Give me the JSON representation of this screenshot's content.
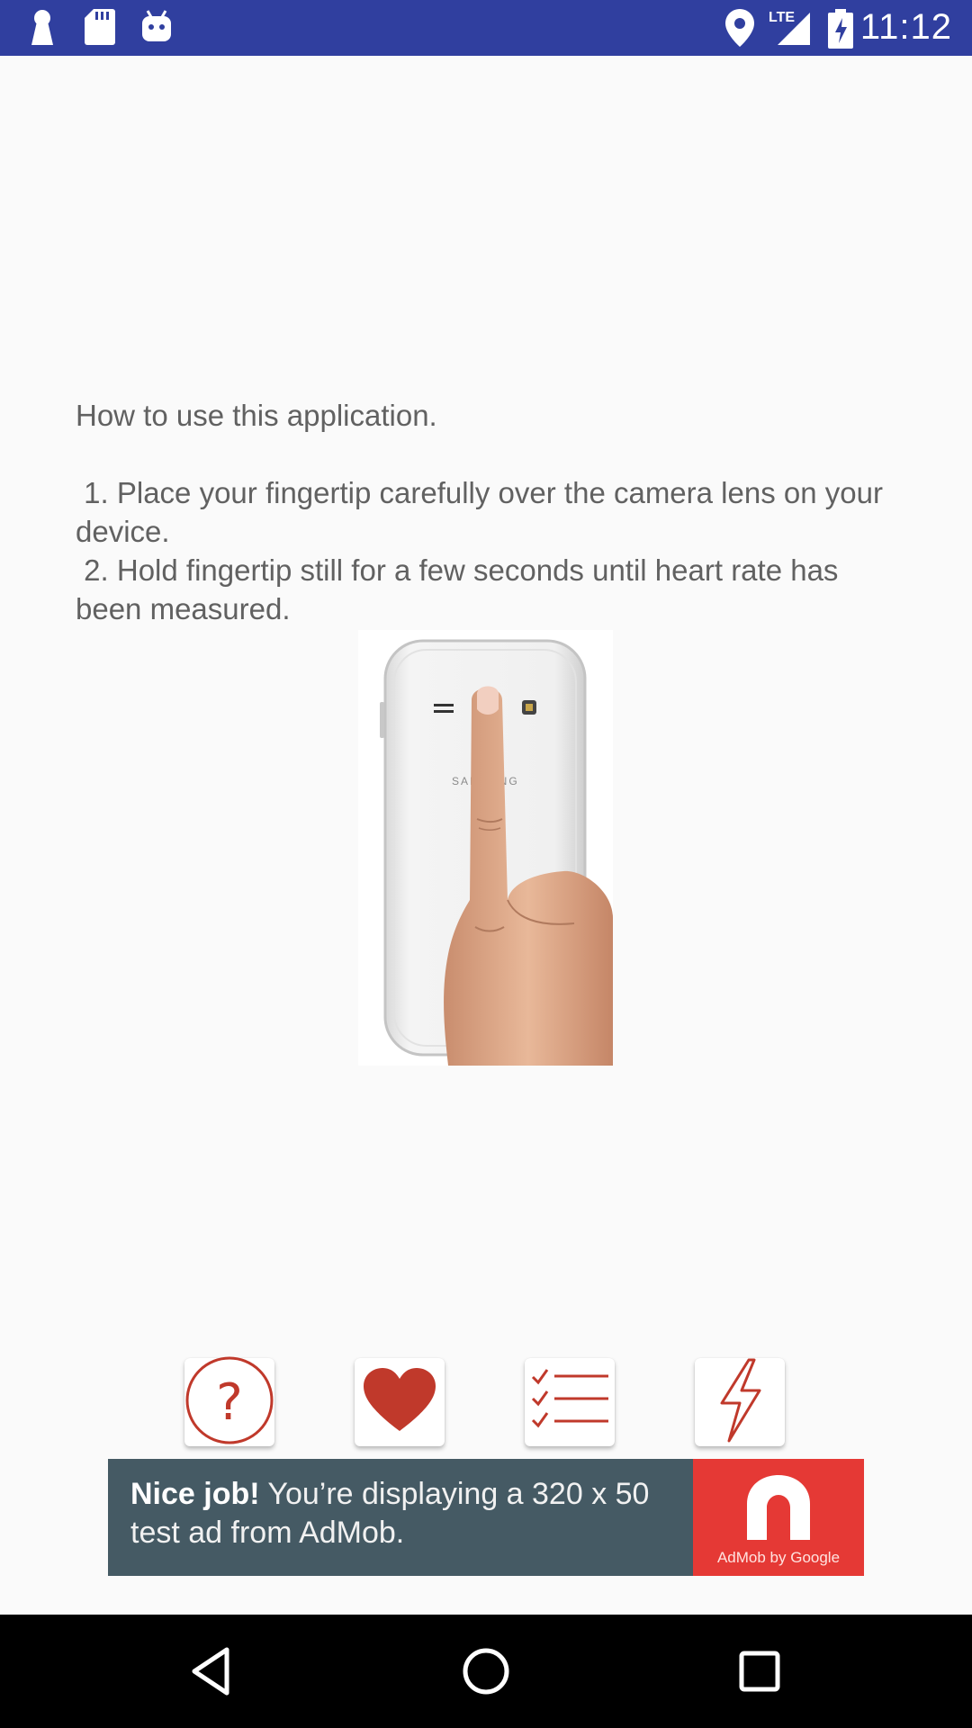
{
  "status_bar": {
    "time": "11:12",
    "network_label": "LTE",
    "left_icons": [
      "keyhole-icon",
      "sd-card-icon",
      "android-icon"
    ],
    "right_icons": [
      "location-icon",
      "signal-icon",
      "battery-charging-icon"
    ]
  },
  "instructions": {
    "heading": "How to use this application.",
    "step1": " 1. Place your fingertip carefully over the camera lens on your device.",
    "step2": " 2. Hold fingertip still for a few seconds until heart rate has been measured.",
    "phone_brand": "SAMSUNG"
  },
  "actions": [
    {
      "name": "help",
      "icon": "question-circle-icon"
    },
    {
      "name": "measure",
      "icon": "heart-icon"
    },
    {
      "name": "history",
      "icon": "checklist-icon"
    },
    {
      "name": "flash",
      "icon": "lightning-icon"
    }
  ],
  "ad": {
    "bold": "Nice job!",
    "text": " You’re displaying a 320 x 50 test ad from AdMob.",
    "logo_caption": "AdMob by Google"
  },
  "nav": [
    "back-icon",
    "home-icon",
    "recents-icon"
  ],
  "colors": {
    "status_bar": "#303f9f",
    "accent": "#c0392b",
    "ad_background": "#455a64",
    "ad_logo": "#e53935"
  }
}
